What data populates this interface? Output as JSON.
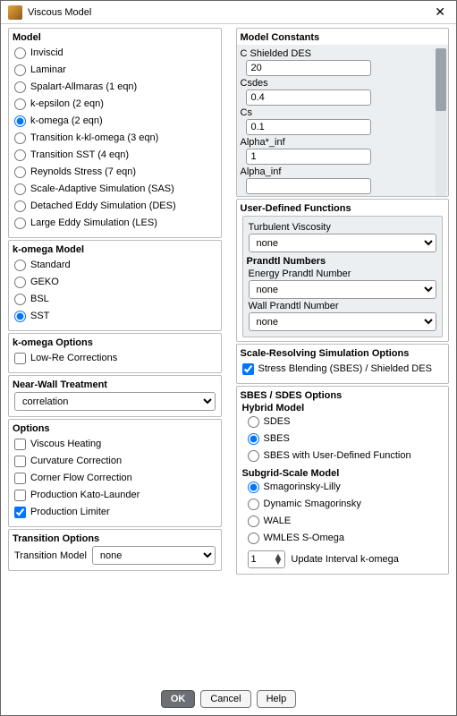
{
  "window": {
    "title": "Viscous Model"
  },
  "left": {
    "model": {
      "title": "Model",
      "options": [
        "Inviscid",
        "Laminar",
        "Spalart-Allmaras (1 eqn)",
        "k-epsilon (2 eqn)",
        "k-omega (2 eqn)",
        "Transition k-kl-omega (3 eqn)",
        "Transition SST (4 eqn)",
        "Reynolds Stress (7 eqn)",
        "Scale-Adaptive Simulation (SAS)",
        "Detached Eddy Simulation (DES)",
        "Large Eddy Simulation (LES)"
      ],
      "selected": 4
    },
    "komega_model": {
      "title": "k-omega Model",
      "options": [
        "Standard",
        "GEKO",
        "BSL",
        "SST"
      ],
      "selected": 3
    },
    "komega_options": {
      "title": "k-omega Options",
      "checks": [
        {
          "label": "Low-Re Corrections",
          "checked": false
        }
      ]
    },
    "near_wall": {
      "title": "Near-Wall Treatment",
      "value": "correlation"
    },
    "options": {
      "title": "Options",
      "checks": [
        {
          "label": "Viscous Heating",
          "checked": false
        },
        {
          "label": "Curvature Correction",
          "checked": false
        },
        {
          "label": "Corner Flow Correction",
          "checked": false
        },
        {
          "label": "Production Kato-Launder",
          "checked": false
        },
        {
          "label": "Production Limiter",
          "checked": true
        }
      ]
    },
    "transition": {
      "title": "Transition Options",
      "label": "Transition Model",
      "value": "none"
    }
  },
  "right": {
    "constants": {
      "title": "Model Constants",
      "items": [
        {
          "label": "C Shielded DES",
          "value": "20"
        },
        {
          "label": "Csdes",
          "value": "0.4"
        },
        {
          "label": "Cs",
          "value": "0.1"
        },
        {
          "label": "Alpha*_inf",
          "value": "1"
        },
        {
          "label": "Alpha_inf",
          "value": ""
        }
      ]
    },
    "udf": {
      "title": "User-Defined Functions",
      "label": "Turbulent Viscosity",
      "value": "none"
    },
    "prandtl": {
      "title": "Prandtl Numbers",
      "items": [
        {
          "label": "Energy Prandtl Number",
          "value": "none"
        },
        {
          "label": "Wall Prandtl Number",
          "value": "none"
        }
      ]
    },
    "srs": {
      "title": "Scale-Resolving Simulation Options",
      "check": {
        "label": "Stress Blending (SBES) / Shielded DES",
        "checked": true
      }
    },
    "sbes": {
      "title": "SBES / SDES Options",
      "hybrid": {
        "title": "Hybrid Model",
        "options": [
          "SDES",
          "SBES",
          "SBES with User-Defined Function"
        ],
        "selected": 1
      },
      "subgrid": {
        "title": "Subgrid-Scale Model",
        "options": [
          "Smagorinsky-Lilly",
          "Dynamic Smagorinsky",
          "WALE",
          "WMLES S-Omega"
        ],
        "selected": 0
      },
      "update": {
        "value": "1",
        "label": "Update Interval k-omega"
      }
    }
  },
  "buttons": {
    "ok": "OK",
    "cancel": "Cancel",
    "help": "Help"
  }
}
